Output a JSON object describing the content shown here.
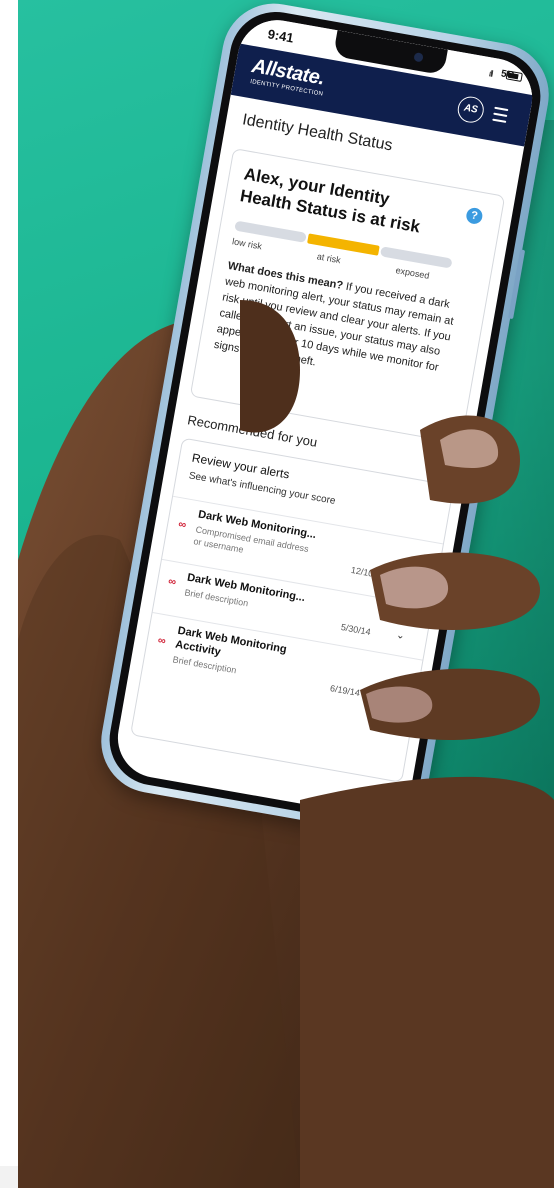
{
  "status_bar": {
    "time": "9:41",
    "network": "5G",
    "signal": "ıll"
  },
  "header": {
    "brand": "Allstate.",
    "brand_sub": "IDENTITY PROTECTION",
    "avatar_initials": "AS"
  },
  "page": {
    "title": "Identity Health Status"
  },
  "health_card": {
    "title": "Alex, your Identity Health Status is at risk",
    "help_glyph": "?",
    "levels": [
      "low risk",
      "at risk",
      "exposed"
    ],
    "current_level": "at risk",
    "explain_bold": "What does this mean?",
    "explain_text": " If you received a dark web monitoring alert, your status may remain at risk until you review and clear your alerts. If you called to report an issue, your status may also appear at risk for 10 days while we monitor for signs of identity theft."
  },
  "recommended": {
    "title": "Recommended for you",
    "card_title": "Review your alerts",
    "card_subtitle": "See what's influencing your score",
    "alerts": [
      {
        "title": "Dark Web Monitoring...",
        "desc": "Compromised email address or username",
        "date": "12/10/13"
      },
      {
        "title": "Dark Web Monitoring...",
        "desc": "Brief description",
        "date": "5/30/14"
      },
      {
        "title": "Dark Web Monitoring Acctivity",
        "desc": "Brief description",
        "date": "6/19/14"
      }
    ]
  },
  "colors": {
    "background": "#1ab48f",
    "header": "#0f1f4d",
    "at_risk": "#f4b400",
    "alert_icon": "#d1263b",
    "help": "#3b9be0"
  }
}
